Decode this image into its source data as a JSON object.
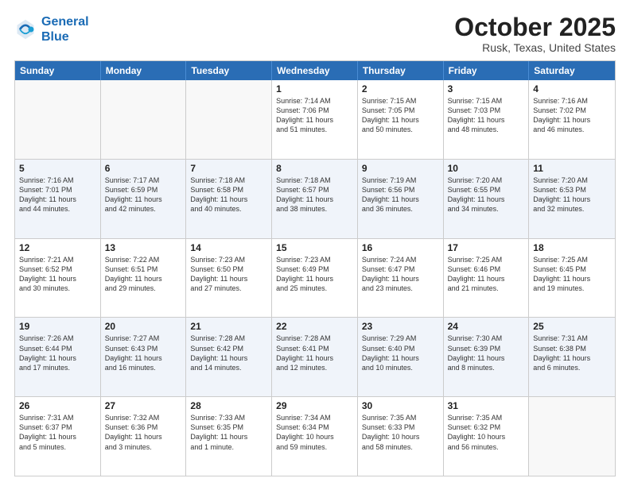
{
  "logo": {
    "line1": "General",
    "line2": "Blue"
  },
  "header": {
    "month": "October 2025",
    "location": "Rusk, Texas, United States"
  },
  "weekdays": [
    "Sunday",
    "Monday",
    "Tuesday",
    "Wednesday",
    "Thursday",
    "Friday",
    "Saturday"
  ],
  "rows": [
    {
      "cells": [
        {
          "day": "",
          "empty": true
        },
        {
          "day": "",
          "empty": true
        },
        {
          "day": "",
          "empty": true
        },
        {
          "day": "1",
          "info": "Sunrise: 7:14 AM\nSunset: 7:06 PM\nDaylight: 11 hours\nand 51 minutes."
        },
        {
          "day": "2",
          "info": "Sunrise: 7:15 AM\nSunset: 7:05 PM\nDaylight: 11 hours\nand 50 minutes."
        },
        {
          "day": "3",
          "info": "Sunrise: 7:15 AM\nSunset: 7:03 PM\nDaylight: 11 hours\nand 48 minutes."
        },
        {
          "day": "4",
          "info": "Sunrise: 7:16 AM\nSunset: 7:02 PM\nDaylight: 11 hours\nand 46 minutes."
        }
      ]
    },
    {
      "cells": [
        {
          "day": "5",
          "info": "Sunrise: 7:16 AM\nSunset: 7:01 PM\nDaylight: 11 hours\nand 44 minutes."
        },
        {
          "day": "6",
          "info": "Sunrise: 7:17 AM\nSunset: 6:59 PM\nDaylight: 11 hours\nand 42 minutes."
        },
        {
          "day": "7",
          "info": "Sunrise: 7:18 AM\nSunset: 6:58 PM\nDaylight: 11 hours\nand 40 minutes."
        },
        {
          "day": "8",
          "info": "Sunrise: 7:18 AM\nSunset: 6:57 PM\nDaylight: 11 hours\nand 38 minutes."
        },
        {
          "day": "9",
          "info": "Sunrise: 7:19 AM\nSunset: 6:56 PM\nDaylight: 11 hours\nand 36 minutes."
        },
        {
          "day": "10",
          "info": "Sunrise: 7:20 AM\nSunset: 6:55 PM\nDaylight: 11 hours\nand 34 minutes."
        },
        {
          "day": "11",
          "info": "Sunrise: 7:20 AM\nSunset: 6:53 PM\nDaylight: 11 hours\nand 32 minutes."
        }
      ]
    },
    {
      "cells": [
        {
          "day": "12",
          "info": "Sunrise: 7:21 AM\nSunset: 6:52 PM\nDaylight: 11 hours\nand 30 minutes."
        },
        {
          "day": "13",
          "info": "Sunrise: 7:22 AM\nSunset: 6:51 PM\nDaylight: 11 hours\nand 29 minutes."
        },
        {
          "day": "14",
          "info": "Sunrise: 7:23 AM\nSunset: 6:50 PM\nDaylight: 11 hours\nand 27 minutes."
        },
        {
          "day": "15",
          "info": "Sunrise: 7:23 AM\nSunset: 6:49 PM\nDaylight: 11 hours\nand 25 minutes."
        },
        {
          "day": "16",
          "info": "Sunrise: 7:24 AM\nSunset: 6:47 PM\nDaylight: 11 hours\nand 23 minutes."
        },
        {
          "day": "17",
          "info": "Sunrise: 7:25 AM\nSunset: 6:46 PM\nDaylight: 11 hours\nand 21 minutes."
        },
        {
          "day": "18",
          "info": "Sunrise: 7:25 AM\nSunset: 6:45 PM\nDaylight: 11 hours\nand 19 minutes."
        }
      ]
    },
    {
      "cells": [
        {
          "day": "19",
          "info": "Sunrise: 7:26 AM\nSunset: 6:44 PM\nDaylight: 11 hours\nand 17 minutes."
        },
        {
          "day": "20",
          "info": "Sunrise: 7:27 AM\nSunset: 6:43 PM\nDaylight: 11 hours\nand 16 minutes."
        },
        {
          "day": "21",
          "info": "Sunrise: 7:28 AM\nSunset: 6:42 PM\nDaylight: 11 hours\nand 14 minutes."
        },
        {
          "day": "22",
          "info": "Sunrise: 7:28 AM\nSunset: 6:41 PM\nDaylight: 11 hours\nand 12 minutes."
        },
        {
          "day": "23",
          "info": "Sunrise: 7:29 AM\nSunset: 6:40 PM\nDaylight: 11 hours\nand 10 minutes."
        },
        {
          "day": "24",
          "info": "Sunrise: 7:30 AM\nSunset: 6:39 PM\nDaylight: 11 hours\nand 8 minutes."
        },
        {
          "day": "25",
          "info": "Sunrise: 7:31 AM\nSunset: 6:38 PM\nDaylight: 11 hours\nand 6 minutes."
        }
      ]
    },
    {
      "cells": [
        {
          "day": "26",
          "info": "Sunrise: 7:31 AM\nSunset: 6:37 PM\nDaylight: 11 hours\nand 5 minutes."
        },
        {
          "day": "27",
          "info": "Sunrise: 7:32 AM\nSunset: 6:36 PM\nDaylight: 11 hours\nand 3 minutes."
        },
        {
          "day": "28",
          "info": "Sunrise: 7:33 AM\nSunset: 6:35 PM\nDaylight: 11 hours\nand 1 minute."
        },
        {
          "day": "29",
          "info": "Sunrise: 7:34 AM\nSunset: 6:34 PM\nDaylight: 10 hours\nand 59 minutes."
        },
        {
          "day": "30",
          "info": "Sunrise: 7:35 AM\nSunset: 6:33 PM\nDaylight: 10 hours\nand 58 minutes."
        },
        {
          "day": "31",
          "info": "Sunrise: 7:35 AM\nSunset: 6:32 PM\nDaylight: 10 hours\nand 56 minutes."
        },
        {
          "day": "",
          "empty": true
        }
      ]
    }
  ]
}
